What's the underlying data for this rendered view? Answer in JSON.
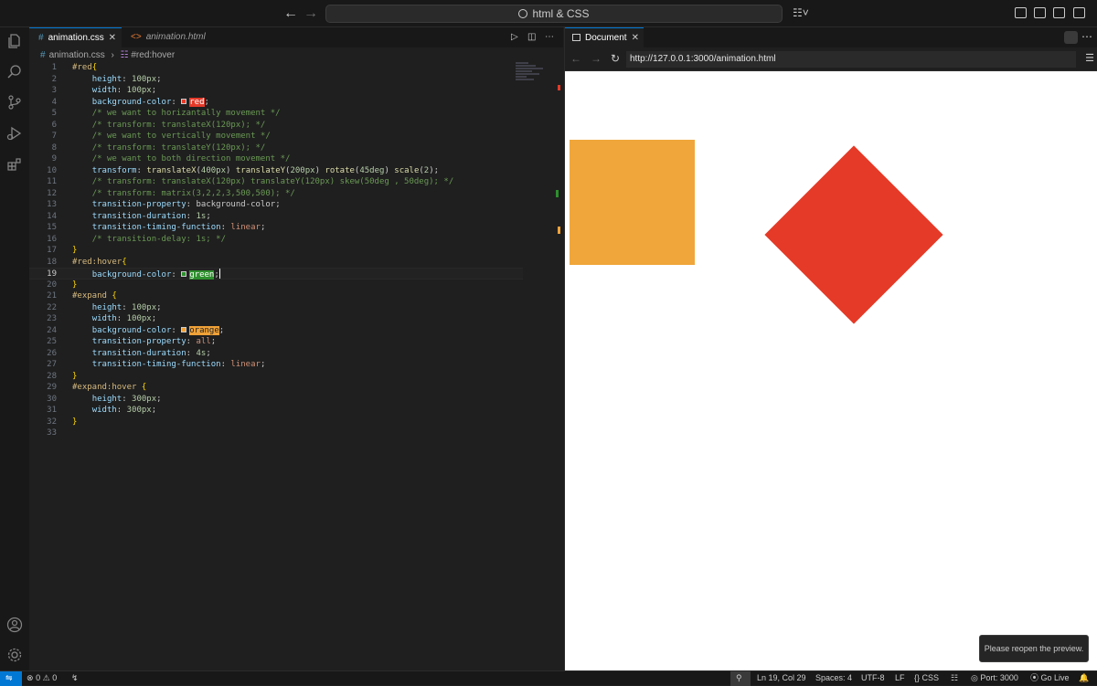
{
  "titlebar": {
    "search_text": "html & CSS",
    "back_icon": "arrow-left-icon",
    "forward_icon": "arrow-right-icon"
  },
  "editor": {
    "tabs": [
      {
        "label": "animation.css",
        "icon": "css-hash-icon",
        "active": true
      },
      {
        "label": "animation.html",
        "icon": "html-brackets-icon",
        "active": false
      }
    ],
    "breadcrumb": {
      "file": "animation.css",
      "symbol": "#red:hover"
    },
    "current_line": 19,
    "lines": [
      "#red{",
      "    height: 100px;",
      "    width: 100px;",
      "    background-color: red;",
      "    /* we want to horizantally movement */",
      "    /* transform: translateX(120px); */",
      "    /* we want to vertically movement */",
      "    /* transform: translateY(120px); */",
      "    /* we want to both direction movement */",
      "    transform: translateX(400px) translateY(200px) rotate(45deg) scale(2);",
      "    /* transform: translateX(120px) translateY(120px) skew(50deg , 50deg); */",
      "    /* transform: matrix(3,2,2,3,500,500); */",
      "    transition-property: background-color;",
      "    transition-duration: 1s;",
      "    transition-timing-function: linear;",
      "    /* transition-delay: 1s; */",
      "}",
      "#red:hover{",
      "    background-color: green;",
      "}",
      "#expand {",
      "    height: 100px;",
      "    width: 100px;",
      "    background-color: orange;",
      "    transition-property: all;",
      "    transition-duration: 4s;",
      "    transition-timing-function: linear;",
      "}",
      "#expand:hover {",
      "    height: 300px;",
      "    width: 300px;",
      "}",
      ""
    ]
  },
  "preview": {
    "tab_label": "Document",
    "url": "http://127.0.0.1:3000/animation.html",
    "toast": "Please reopen the preview.",
    "colors": {
      "orange_box": "#f0a63a",
      "red_box": "#e53a27"
    }
  },
  "statusbar": {
    "errors": "0",
    "warnings": "0",
    "position": "Ln 19, Col 29",
    "spaces": "Spaces: 4",
    "encoding": "UTF-8",
    "eol": "LF",
    "language": "CSS",
    "port": "Port: 3000",
    "golive": "Go Live"
  }
}
